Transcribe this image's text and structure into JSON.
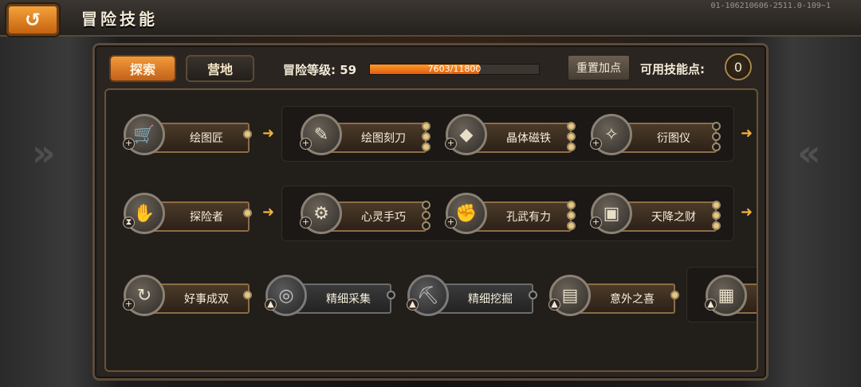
{
  "header": {
    "back_icon": "back-arrow-icon",
    "title": "冒险技能",
    "version": "01-106210606-2511.0-109~1"
  },
  "tabs": [
    {
      "label": "探索",
      "active": true
    },
    {
      "label": "营地",
      "active": false
    }
  ],
  "level": {
    "label": "冒险等级: 59",
    "exp_text": "7603/11800",
    "exp_current": 7603,
    "exp_max": 11800
  },
  "reset_label": "重置加点",
  "points": {
    "label": "可用技能点:",
    "value": "0"
  },
  "colors": {
    "accent": "#e8872a",
    "panel": "#2a2521",
    "border": "#6a5337"
  },
  "skills": {
    "row1": [
      "绘图匠",
      "绘图刻刀",
      "晶体磁铁",
      "衍图仪"
    ],
    "row2": [
      "探险者",
      "心灵手巧",
      "孔武有力",
      "天降之财"
    ],
    "row3": [
      "好事成双",
      "精细采集",
      "精细挖掘",
      "意外之喜"
    ]
  }
}
